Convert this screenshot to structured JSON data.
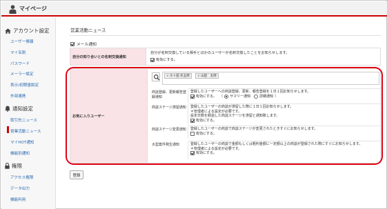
{
  "header": {
    "title": "マイページ"
  },
  "sidebar": {
    "sections": [
      {
        "heading": "アカウント設定",
        "icon": "house-icon",
        "items": [
          {
            "label": "ユーザー情報"
          },
          {
            "label": "マイ名刺"
          },
          {
            "label": "パスワード"
          },
          {
            "label": "メーラー設定"
          },
          {
            "label": "表示/初期値設定"
          },
          {
            "label": "外部連携"
          }
        ]
      },
      {
        "heading": "通知設定",
        "icon": "bell-icon",
        "items": [
          {
            "label": "取引先ニュース"
          },
          {
            "label": "営業活動ニュース",
            "active": true
          },
          {
            "label": "マイHOT通知"
          },
          {
            "label": "機能別通知"
          }
        ]
      },
      {
        "heading": "権限",
        "icon": "lock-icon",
        "items": [
          {
            "label": "アクセス権限"
          },
          {
            "label": "データ出力"
          },
          {
            "label": "機能利用"
          }
        ]
      }
    ]
  },
  "main": {
    "title": "営業活動ニュース",
    "mail_notify": {
      "label": "メール通知",
      "checked": true
    },
    "row_exchange": {
      "label": "自分の知り合いとの名刺交換通知",
      "description": "自分が名刺交換している相手とほかのユーザーが名刺交換したことをお知らせします。",
      "checkbox_label": "有効にする。",
      "checked": true
    },
    "favorites": {
      "label": "お気に入りユーザー",
      "tags": [
        "ホト田 矢五郎",
        "山田　太郎"
      ],
      "rows": [
        {
          "label": "商談登録、更新報告登録通知",
          "lines": [
            "登録したユーザーへの商談登録、更新、報告登録を１日１回お知らせします。"
          ],
          "check_label": "有効にする。",
          "radio_options": [
            {
              "label": "サマリー通知",
              "checked": true
            },
            {
              "label": "詳細通知",
              "checked": false
            }
          ]
        },
        {
          "label": "商談ステージ滞留通知",
          "lines": [
            "登録したユーザーの商談が滞留した際に１日１回お知らせします。",
            "＊管理者による設定が必要です。",
            "設定日数を経過した商談ステージを滞留と通知致します。"
          ],
          "check_label": "有効にする。"
        },
        {
          "label": "商談ステージ変更通知",
          "lines": [
            "登録したユーザーの商談で商談ステージが変更されたときすぐにお知らせします。"
          ],
          "check_label": "有効にする。"
        },
        {
          "label": "大型案件発生通知",
          "lines": [
            "登録したユーザーの商談で金額もしくは粗利金額に一定額以上の商談が登録された際にすぐにお知らせします。",
            "＊管理者による設定が必要です。"
          ],
          "check_label": "有効にする。"
        }
      ]
    },
    "submit_label": "登録"
  },
  "colors": {
    "accent_red": "#e00012",
    "label_bg": "#f9e3e6",
    "link": "#2a6ab0"
  }
}
